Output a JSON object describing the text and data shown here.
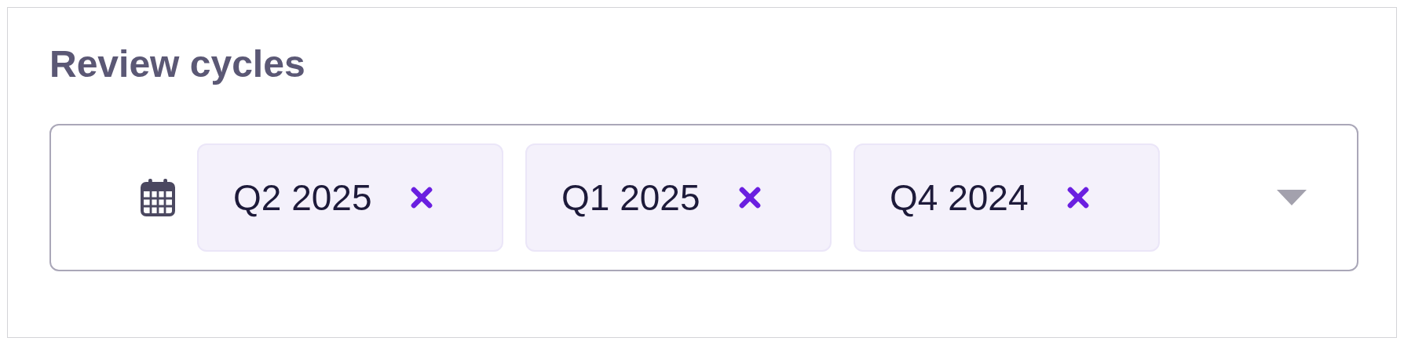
{
  "title": "Review cycles",
  "field": {
    "chips": [
      {
        "label": "Q2 2025"
      },
      {
        "label": "Q1 2025"
      },
      {
        "label": "Q4 2024"
      }
    ]
  }
}
